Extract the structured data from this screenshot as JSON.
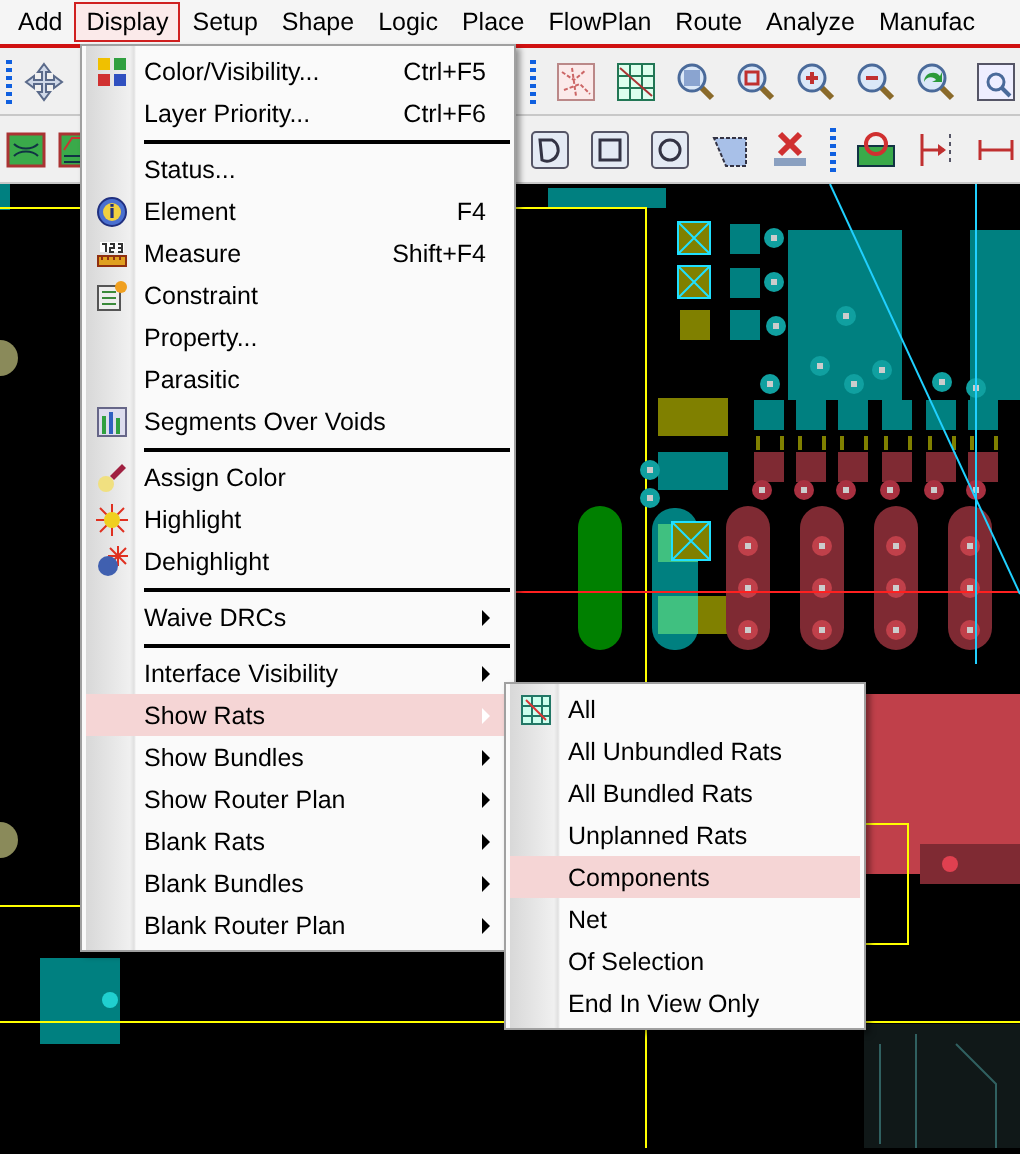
{
  "menu_bar": [
    {
      "label": "Add",
      "selected": false
    },
    {
      "label": "Display",
      "selected": true
    },
    {
      "label": "Setup",
      "selected": false
    },
    {
      "label": "Shape",
      "selected": false
    },
    {
      "label": "Logic",
      "selected": false
    },
    {
      "label": "Place",
      "selected": false
    },
    {
      "label": "FlowPlan",
      "selected": false
    },
    {
      "label": "Route",
      "selected": false
    },
    {
      "label": "Analyze",
      "selected": false
    },
    {
      "label": "Manufac",
      "selected": false
    }
  ],
  "display_menu": {
    "items": [
      {
        "kind": "item",
        "label": "Color/Visibility...",
        "shortcut": "Ctrl+F5",
        "submenu": false,
        "selected": false
      },
      {
        "kind": "item",
        "label": "Layer Priority...",
        "shortcut": "Ctrl+F6",
        "submenu": false,
        "selected": false
      },
      {
        "kind": "separator"
      },
      {
        "kind": "item",
        "label": "Status...",
        "submenu": false,
        "selected": false
      },
      {
        "kind": "item",
        "label": "Element",
        "shortcut": "F4",
        "submenu": false,
        "selected": false
      },
      {
        "kind": "item",
        "label": "Measure",
        "shortcut": "Shift+F4",
        "submenu": false,
        "selected": false
      },
      {
        "kind": "item",
        "label": "Constraint",
        "submenu": false,
        "selected": false
      },
      {
        "kind": "item",
        "label": "Property...",
        "submenu": false,
        "selected": false
      },
      {
        "kind": "item",
        "label": "Parasitic",
        "submenu": false,
        "selected": false
      },
      {
        "kind": "item",
        "label": "Segments Over Voids",
        "submenu": false,
        "selected": false
      },
      {
        "kind": "separator"
      },
      {
        "kind": "item",
        "label": "Assign Color",
        "submenu": false,
        "selected": false
      },
      {
        "kind": "item",
        "label": "Highlight",
        "submenu": false,
        "selected": false
      },
      {
        "kind": "item",
        "label": "Dehighlight",
        "submenu": false,
        "selected": false
      },
      {
        "kind": "separator"
      },
      {
        "kind": "item",
        "label": "Waive DRCs",
        "submenu": true,
        "selected": false
      },
      {
        "kind": "separator"
      },
      {
        "kind": "item",
        "label": "Interface Visibility",
        "submenu": true,
        "selected": false
      },
      {
        "kind": "item",
        "label": "Show Rats",
        "submenu": true,
        "selected": true
      },
      {
        "kind": "item",
        "label": "Show Bundles",
        "submenu": true,
        "selected": false
      },
      {
        "kind": "item",
        "label": "Show Router Plan",
        "submenu": true,
        "selected": false
      },
      {
        "kind": "item",
        "label": "Blank Rats",
        "submenu": true,
        "selected": false
      },
      {
        "kind": "item",
        "label": "Blank Bundles",
        "submenu": true,
        "selected": false
      },
      {
        "kind": "item",
        "label": "Blank Router Plan",
        "submenu": true,
        "selected": false
      }
    ]
  },
  "show_rats_submenu": {
    "items": [
      {
        "label": "All",
        "selected": false
      },
      {
        "label": "All Unbundled Rats",
        "selected": false
      },
      {
        "label": "All Bundled Rats",
        "selected": false
      },
      {
        "label": "Unplanned Rats",
        "selected": false
      },
      {
        "label": "Components",
        "selected": true
      },
      {
        "label": "Net",
        "selected": false
      },
      {
        "label": "Of Selection",
        "selected": false
      },
      {
        "label": "End In View Only",
        "selected": false
      }
    ]
  }
}
